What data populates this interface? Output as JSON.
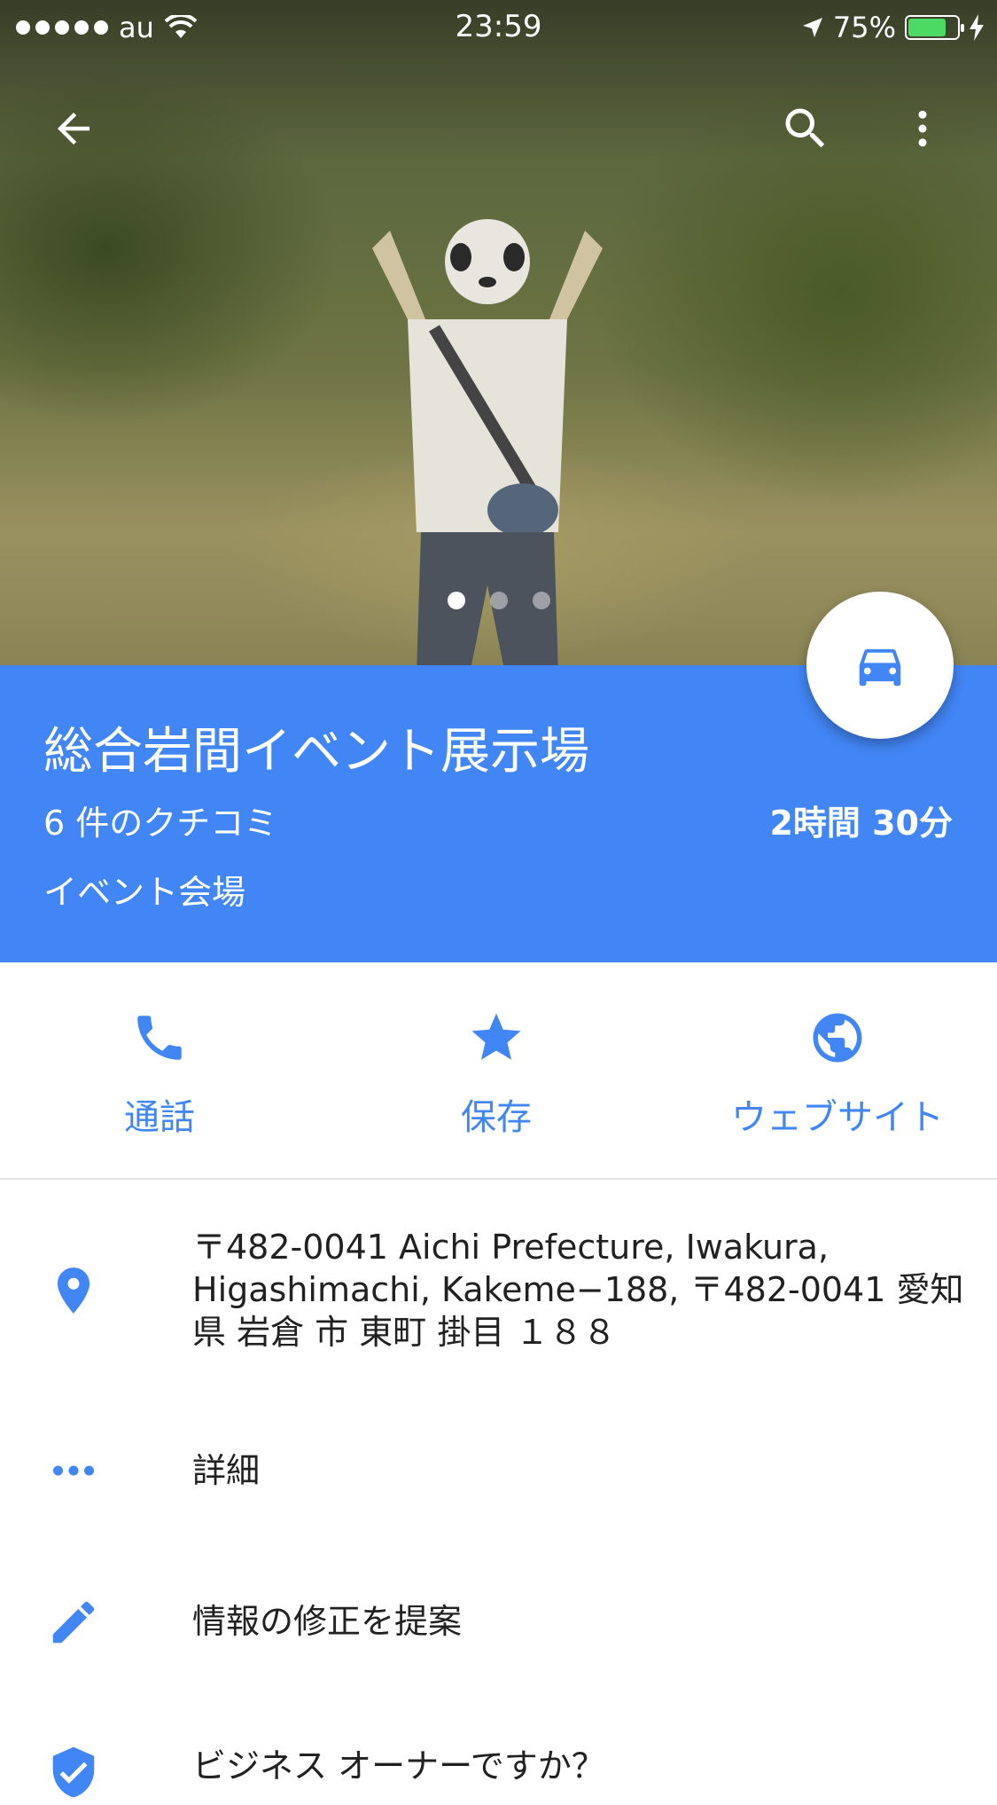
{
  "status_bar": {
    "carrier": "au",
    "time": "23:59",
    "battery_percent": "75%",
    "battery_level": 0.75
  },
  "hero": {
    "photo_count": 3,
    "active_index": 0
  },
  "place": {
    "name": "総合岩間イベント展示場",
    "reviews": "6 件のクチコミ",
    "travel_time": "2時間 30分",
    "category": "イベント会場"
  },
  "actions": [
    {
      "label": "通話",
      "icon": "phone-icon"
    },
    {
      "label": "保存",
      "icon": "star-icon"
    },
    {
      "label": "ウェブサイト",
      "icon": "globe-icon"
    }
  ],
  "info_rows": {
    "address_line1": "〒482-0041 Aichi Prefecture, Iwakura,",
    "address_line2": "Higashimachi, Kakeme−188, 〒482-0041 愛知",
    "address_line3": "県 岩倉 市 東町 掛目 １８８",
    "details": "詳細",
    "suggest_edit": "情報の修正を提案",
    "owner": "ビジネス オーナーですか？"
  },
  "colors": {
    "accent": "#4285f4",
    "text": "#212121",
    "battery": "#4cd964"
  }
}
